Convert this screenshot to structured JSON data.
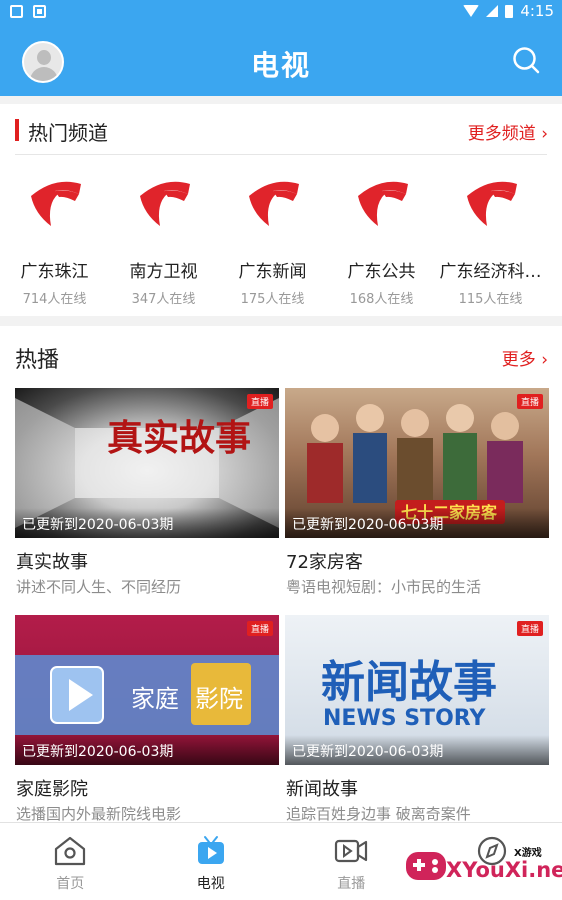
{
  "status_bar": {
    "time": "4:15"
  },
  "header": {
    "title": "电视"
  },
  "hot_channels": {
    "title": "热门频道",
    "more": "更多频道 ›",
    "items": [
      {
        "name": "广东珠江",
        "count": "714人在线"
      },
      {
        "name": "南方卫视",
        "count": "347人在线"
      },
      {
        "name": "广东新闻",
        "count": "175人在线"
      },
      {
        "name": "广东公共",
        "count": "168人在线"
      },
      {
        "name": "广东经济科…",
        "count": "115人在线"
      }
    ]
  },
  "hot_broadcast": {
    "title": "热播",
    "more": "更多 ›",
    "live_badge": "直播",
    "items": [
      {
        "name": "真实故事",
        "desc": "讲述不同人生、不同经历",
        "updated": "已更新到2020-06-03期",
        "thumb_text": "真实故事"
      },
      {
        "name": "72家房客",
        "desc": "粤语电视短剧：小市民的生活",
        "updated": "已更新到2020-06-03期",
        "thumb_text": "七十二家房客"
      },
      {
        "name": "家庭影院",
        "desc": "选播国内外最新院线电影",
        "updated": "已更新到2020-06-03期",
        "thumb_text_1": "家庭",
        "thumb_text_2": "影院"
      },
      {
        "name": "新闻故事",
        "desc": "追踪百姓身边事 破离奇案件",
        "updated": "已更新到2020-06-03期",
        "thumb_text_1": "新闻故事",
        "thumb_text_2": "NEWS STORY"
      }
    ]
  },
  "bottom_nav": {
    "items": [
      {
        "label": "首页",
        "icon": "home-icon"
      },
      {
        "label": "电视",
        "icon": "tv-icon"
      },
      {
        "label": "直播",
        "icon": "video-icon"
      },
      {
        "label": "",
        "icon": "compass-icon"
      }
    ],
    "active": "电视"
  },
  "watermark": {
    "text": "XYouXi.net",
    "small": "X游戏"
  },
  "colors": {
    "primary": "#3ba6f0",
    "accent": "#e02020",
    "muted": "#999999"
  }
}
